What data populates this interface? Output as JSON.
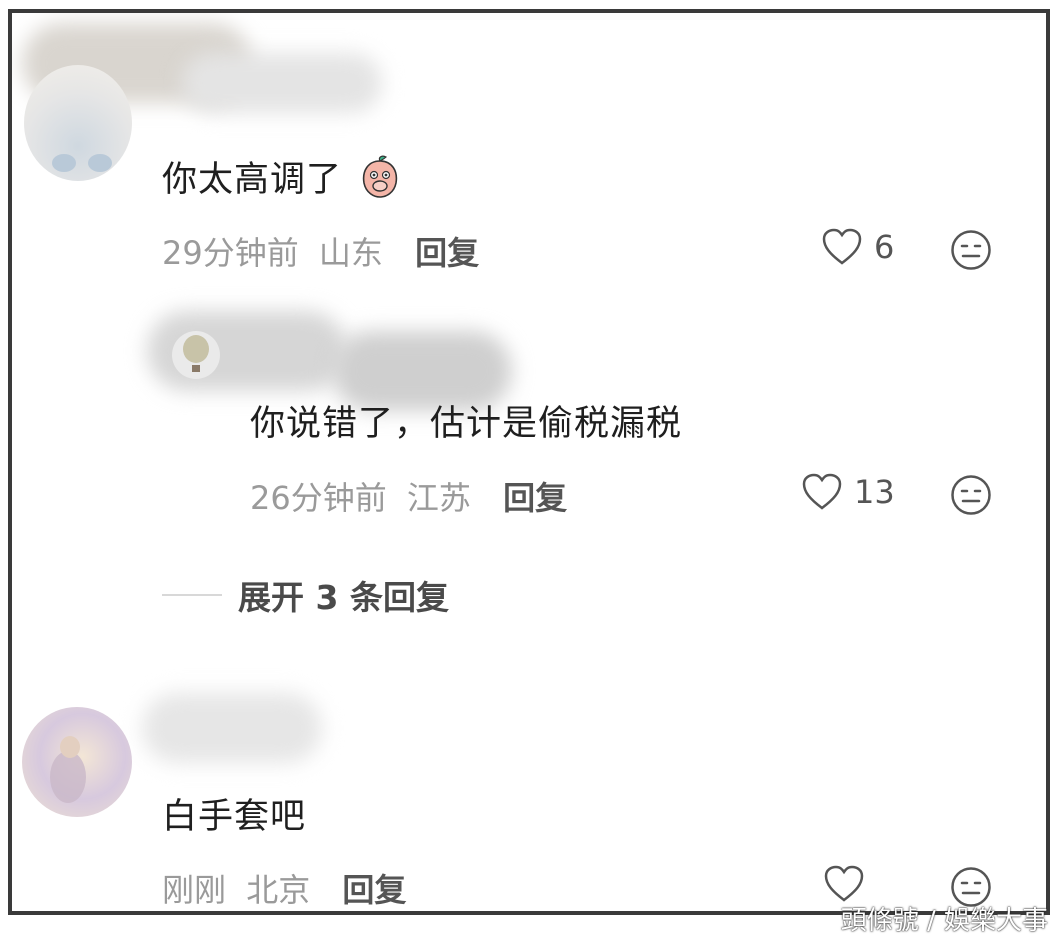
{
  "comments": [
    {
      "text": "你太高调了",
      "time": "29分钟前",
      "location": "山东",
      "reply_label": "回复",
      "likes": "6",
      "emoji_icon": "peach-covering-mouth-emoji"
    },
    {
      "text": "你说错了，估计是偷税漏税",
      "time": "26分钟前",
      "location": "江苏",
      "reply_label": "回复",
      "likes": "13"
    },
    {
      "text": "白手套吧",
      "time": "刚刚",
      "location": "北京",
      "reply_label": "回复",
      "likes": ""
    }
  ],
  "expand_label": "展开 3 条回复",
  "watermark": "頭條號 / 娛樂大事",
  "icons": {
    "like": "heart-outline-icon",
    "dislike": "neutral-face-icon"
  },
  "colors": {
    "text": "#1f1f1f",
    "meta": "#9a9a9a",
    "action": "#555555",
    "border": "#3a3a3a"
  }
}
